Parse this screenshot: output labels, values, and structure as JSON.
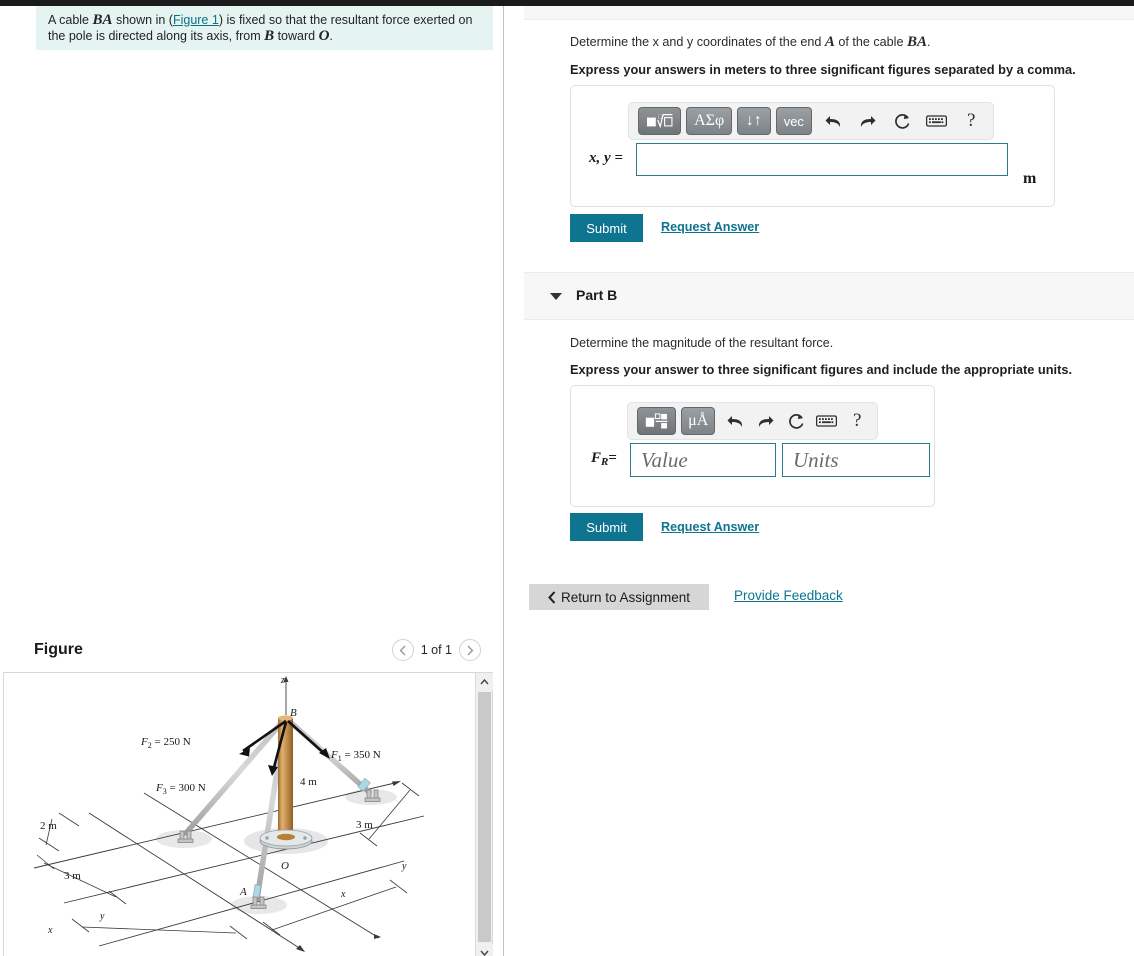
{
  "problem": {
    "text_prefix": "A cable ",
    "cable_label": "BA",
    "text_mid1": " shown in (",
    "figure_link": "Figure 1",
    "text_mid2": ") is fixed so that the resultant force exerted on the pole is directed along its axis, from ",
    "point_b": "B",
    "text_mid3": " toward ",
    "point_o": "O",
    "text_end": "."
  },
  "part_a": {
    "question_pre": "Determine the x and y coordinates of the end ",
    "question_var_a": "A",
    "question_mid": " of the cable ",
    "question_var_ba": "BA",
    "question_end": ".",
    "instruction": "Express your answers in meters to three significant figures separated by a comma.",
    "toolbar": {
      "template_btn": "template-icon",
      "greek_btn": "ΑΣφ",
      "updown_btn": "↓↑",
      "vec_btn": "vec",
      "undo": "undo-icon",
      "redo": "redo-icon",
      "reset": "reset-icon",
      "keyboard": "keyboard-icon",
      "help": "?"
    },
    "var_label": "x, y =",
    "input_value": "",
    "input_placeholder": "",
    "unit": "m",
    "submit_label": "Submit",
    "request_answer_label": "Request Answer"
  },
  "part_b": {
    "title": "Part B",
    "question": "Determine the magnitude of the resultant force.",
    "instruction": "Express your answer to three significant figures and include the appropriate units.",
    "toolbar": {
      "template_btn": "template-fraction-icon",
      "units_btn": "μÅ",
      "undo": "undo-icon",
      "redo": "redo-icon",
      "reset": "reset-icon",
      "keyboard": "keyboard-icon",
      "help": "?"
    },
    "var_label_main": "F",
    "var_label_sub": "R",
    "var_label_eq": "=",
    "value_placeholder": "Value",
    "units_placeholder": "Units",
    "value_current": "",
    "units_current": "",
    "submit_label": "Submit",
    "request_answer_label": "Request Answer"
  },
  "footer": {
    "return_label": "Return to Assignment",
    "return_icon": "chevron-left-icon",
    "feedback_label": "Provide Feedback"
  },
  "figure": {
    "title": "Figure",
    "pager_prev": "‹",
    "pager_next": "›",
    "pager_label": "1 of 1",
    "diagram": {
      "axis_z": "z",
      "axis_x_left": "x",
      "axis_y_left": "y",
      "axis_x_right": "x",
      "axis_y_right": "y",
      "point_b": "B",
      "point_o": "O",
      "point_a": "A",
      "force_1": "F₁ = 350 N",
      "force_1_main": "F",
      "force_1_sub": "1",
      "force_1_val": " = 350 N",
      "force_2_main": "F",
      "force_2_sub": "2",
      "force_2_val": " = 250 N",
      "force_3_main": "F",
      "force_3_sub": "3",
      "force_3_val": " = 300 N",
      "dim_pole": "4 m",
      "dim_2m": "2 m",
      "dim_3m_left": "3 m",
      "dim_3m_right": "3 m"
    }
  },
  "colors": {
    "accent": "#0e7490",
    "problem_bg": "#e6f4f1",
    "band_bg": "#f7f7f7",
    "input_border": "#2b7a8c",
    "pole": "#c8924a"
  }
}
